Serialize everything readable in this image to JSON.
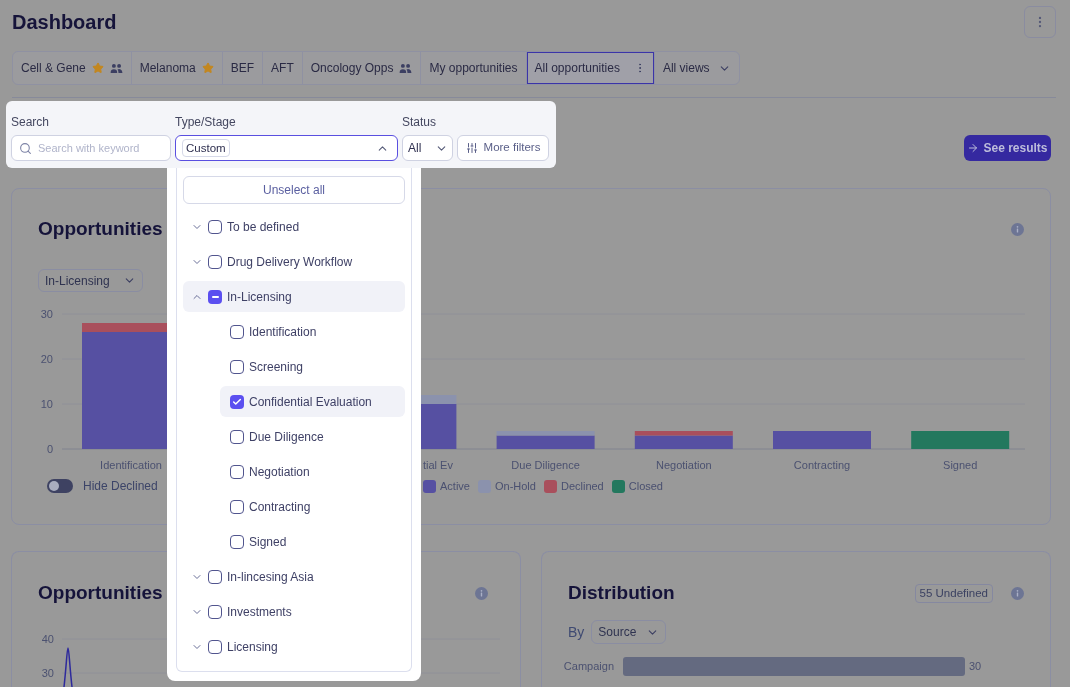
{
  "page": {
    "title": "Dashboard"
  },
  "tabs": [
    {
      "label": "Cell & Gene",
      "selected": false,
      "favorite": true,
      "shared": true
    },
    {
      "label": "Melanoma",
      "selected": false,
      "favorite": true,
      "shared": false
    },
    {
      "label": "BEF",
      "selected": false,
      "favorite": false,
      "shared": false
    },
    {
      "label": "AFT",
      "selected": false,
      "favorite": false,
      "shared": false
    },
    {
      "label": "Oncology Opps",
      "selected": false,
      "favorite": false,
      "shared": true
    },
    {
      "label": "My opportunities",
      "selected": false,
      "favorite": false,
      "shared": false
    },
    {
      "label": "All opportunities",
      "selected": true,
      "favorite": false,
      "shared": false
    }
  ],
  "views_menu": {
    "label": "All views"
  },
  "filters": {
    "search": {
      "label": "Search",
      "placeholder": "Search with keyword"
    },
    "type_stage": {
      "label": "Type/Stage",
      "chips": [
        "Custom"
      ],
      "open": true
    },
    "status": {
      "label": "Status",
      "value": "All"
    },
    "more_filters": {
      "label": "More filters"
    },
    "see_results": {
      "label": "See results"
    }
  },
  "type_stage_menu": {
    "unselect_all": "Unselect all",
    "items": [
      {
        "label": "To be defined",
        "expanded": false,
        "checked": false,
        "indeterminate": false
      },
      {
        "label": "Drug Delivery Workflow",
        "expanded": false,
        "checked": false,
        "indeterminate": false
      },
      {
        "label": "In-Licensing",
        "expanded": true,
        "checked": false,
        "indeterminate": true,
        "children": [
          {
            "label": "Identification",
            "checked": false
          },
          {
            "label": "Screening",
            "checked": false
          },
          {
            "label": "Confidential Evaluation",
            "checked": true
          },
          {
            "label": "Due Diligence",
            "checked": false
          },
          {
            "label": "Negotiation",
            "checked": false
          },
          {
            "label": "Contracting",
            "checked": false
          },
          {
            "label": "Signed",
            "checked": false
          }
        ]
      },
      {
        "label": "In-lincesing Asia",
        "expanded": false,
        "checked": false,
        "indeterminate": false
      },
      {
        "label": "Investments",
        "expanded": false,
        "checked": false,
        "indeterminate": false
      },
      {
        "label": "Licensing",
        "expanded": false,
        "checked": false,
        "indeterminate": false
      }
    ]
  },
  "stage_card": {
    "title": "Opportunities",
    "type_select": "In-Licensing",
    "chart_data": {
      "type": "bar",
      "stacked": true,
      "categories": [
        "Identification",
        null,
        "tial Ev",
        "Due Diligence",
        "Negotiation",
        "Contracting",
        "Signed"
      ],
      "series": [
        {
          "name": "Active",
          "color": "#5650a2",
          "values": [
            26,
            null,
            10,
            3,
            3,
            4,
            0
          ]
        },
        {
          "name": "On-Hold",
          "color": "#8b92ad",
          "values": [
            0,
            null,
            2,
            1,
            0,
            0,
            0
          ]
        },
        {
          "name": "Declined",
          "color": "#a94f5c",
          "values": [
            2,
            null,
            0,
            0,
            1,
            0,
            0
          ]
        },
        {
          "name": "Closed",
          "color": "#23785e",
          "values": [
            0,
            null,
            0,
            0,
            0,
            0,
            4
          ]
        }
      ],
      "ylim": [
        0,
        30
      ],
      "yticks": [
        0,
        10,
        20,
        30
      ]
    },
    "hide_declined": {
      "label": "Hide Declined",
      "on": false
    }
  },
  "trend_card": {
    "title": "Opportunities",
    "y_tick_labels": [
      "40",
      "30"
    ]
  },
  "distribution_card": {
    "title": "Distribution",
    "undefined_badge": "55 Undefined",
    "by_label": "By",
    "by_select": "Source",
    "chart_data": {
      "type": "bar",
      "orientation": "horizontal",
      "categories": [
        "Campaign"
      ],
      "values": [
        30
      ],
      "data_labels": true
    }
  }
}
